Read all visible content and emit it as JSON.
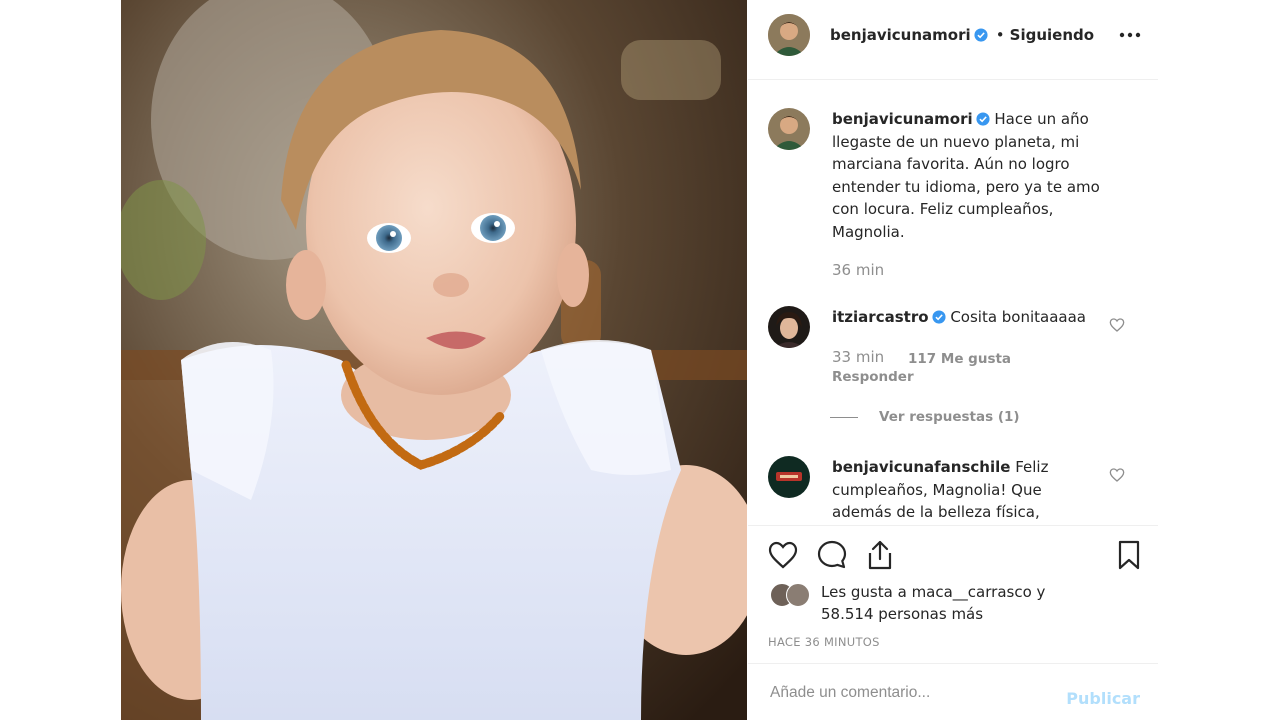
{
  "colors": {
    "accent": "#3897f0",
    "muted": "#8e8e8e",
    "text": "#262626",
    "publish_disabled": "#b2dffc",
    "border": "#efefef"
  },
  "header": {
    "username": "benjavicunamori",
    "separator": "•",
    "follow_status": "Siguiendo",
    "more_icon": "more-options-icon"
  },
  "caption": {
    "username": "benjavicunamori",
    "lines": [
      "Hace un año",
      "llegaste de un nuevo planeta, mi",
      "marciana favorita. Aún no logro",
      "entender tu idioma, pero ya te amo",
      "con locura. Feliz cumpleaños,",
      "Magnolia."
    ],
    "time": "36 min"
  },
  "comments": [
    {
      "username": "itziarcastro",
      "text": "Cosita bonitaaaaa",
      "time": "33 min",
      "likes": "117 Me gusta",
      "reply": "Responder",
      "view_replies": "Ver respuestas (1)"
    },
    {
      "username": "benjavicunafanschile",
      "lines": [
        "Feliz",
        "cumpleaños, Magnolia! Que",
        "además de la belleza física,"
      ]
    }
  ],
  "actions": {
    "like_icon": "heart-icon",
    "comment_icon": "comment-bubble-icon",
    "share_icon": "share-icon",
    "save_icon": "bookmark-icon"
  },
  "likes": {
    "line1_prefix": "Les gusta a",
    "liker": "maca__carrasco",
    "line1_suffix": "y",
    "line2": "58.514 personas más"
  },
  "posted": "HACE 36 MINUTOS",
  "add_comment": {
    "placeholder": "Añade un comentario...",
    "publish_label": "Publicar"
  }
}
